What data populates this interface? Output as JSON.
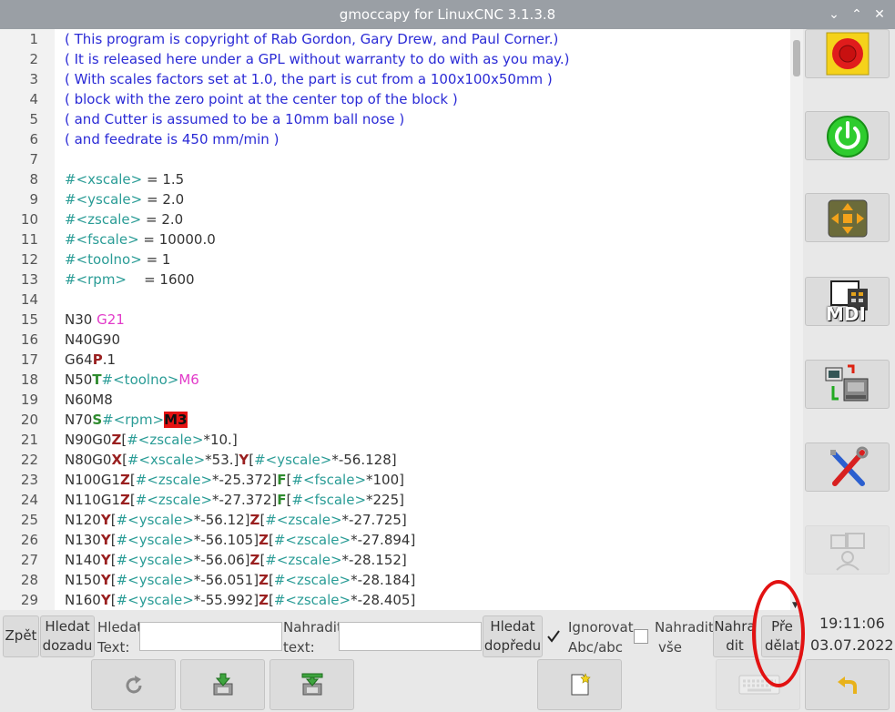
{
  "window": {
    "title": "gmoccapy for LinuxCNC  3.1.3.8",
    "min_icon": "chevron-down-icon",
    "max_icon": "chevron-up-icon",
    "close_icon": "close-icon",
    "min": "⌄",
    "max": "⌃",
    "close": "✕"
  },
  "editor": {
    "lines": [
      {
        "n": "1",
        "parts": [
          [
            "cm",
            "( This program is copyright of Rab Gordon, Gary Drew, and Paul Corner.)"
          ]
        ]
      },
      {
        "n": "2",
        "parts": [
          [
            "cm",
            "( It is released here under a GPL without warranty to do with as you may.)"
          ]
        ]
      },
      {
        "n": "3",
        "parts": [
          [
            "cm",
            "( With scales factors set at 1.0, the part is cut from a 100x100x50mm )"
          ]
        ]
      },
      {
        "n": "4",
        "parts": [
          [
            "cm",
            "( block with the zero point at the center top of the block )"
          ]
        ]
      },
      {
        "n": "5",
        "parts": [
          [
            "cm",
            "( and Cutter is assumed to be a 10mm ball nose )"
          ]
        ]
      },
      {
        "n": "6",
        "parts": [
          [
            "cm",
            "( and feedrate is 450 mm/min )"
          ]
        ]
      },
      {
        "n": "7",
        "parts": []
      },
      {
        "n": "8",
        "parts": [
          [
            "var",
            "#<xscale>"
          ],
          [
            "txt",
            " = 1.5"
          ]
        ]
      },
      {
        "n": "9",
        "parts": [
          [
            "var",
            "#<yscale>"
          ],
          [
            "txt",
            " = 2.0"
          ]
        ]
      },
      {
        "n": "10",
        "parts": [
          [
            "var",
            "#<zscale>"
          ],
          [
            "txt",
            " = 2.0"
          ]
        ]
      },
      {
        "n": "11",
        "parts": [
          [
            "var",
            "#<fscale>"
          ],
          [
            "txt",
            " = 10000.0"
          ]
        ]
      },
      {
        "n": "12",
        "parts": [
          [
            "var",
            "#<toolno>"
          ],
          [
            "txt",
            " = 1"
          ]
        ]
      },
      {
        "n": "13",
        "parts": [
          [
            "var",
            "#<rpm>"
          ],
          [
            "txt",
            "    = 1600"
          ]
        ]
      },
      {
        "n": "14",
        "parts": []
      },
      {
        "n": "15",
        "parts": [
          [
            "txt",
            "N30 "
          ],
          [
            "g",
            "G21"
          ]
        ]
      },
      {
        "n": "16",
        "parts": [
          [
            "txt",
            "N40G90"
          ]
        ]
      },
      {
        "n": "17",
        "parts": [
          [
            "txt",
            "G64"
          ],
          [
            "addr",
            "P"
          ],
          [
            "txt",
            ".1"
          ]
        ]
      },
      {
        "n": "18",
        "parts": [
          [
            "txt",
            "N50"
          ],
          [
            "addrg",
            "T"
          ],
          [
            "var",
            "#<toolno>"
          ],
          [
            "g",
            "M6"
          ]
        ]
      },
      {
        "n": "19",
        "parts": [
          [
            "txt",
            "N60M8"
          ]
        ]
      },
      {
        "n": "20",
        "parts": [
          [
            "txt",
            "N70"
          ],
          [
            "addrg",
            "S"
          ],
          [
            "var",
            "#<rpm>"
          ],
          [
            "hl",
            "M3"
          ]
        ]
      },
      {
        "n": "21",
        "parts": [
          [
            "txt",
            "N90G0"
          ],
          [
            "addr",
            "Z"
          ],
          [
            "txt",
            "["
          ],
          [
            "var",
            "#<zscale>"
          ],
          [
            "txt",
            "*10.]"
          ]
        ]
      },
      {
        "n": "22",
        "parts": [
          [
            "txt",
            "N80G0"
          ],
          [
            "addr",
            "X"
          ],
          [
            "txt",
            "["
          ],
          [
            "var",
            "#<xscale>"
          ],
          [
            "txt",
            "*53.]"
          ],
          [
            "addr",
            "Y"
          ],
          [
            "txt",
            "["
          ],
          [
            "var",
            "#<yscale>"
          ],
          [
            "txt",
            "*-56.128]"
          ]
        ]
      },
      {
        "n": "23",
        "parts": [
          [
            "txt",
            "N100G1"
          ],
          [
            "addr",
            "Z"
          ],
          [
            "txt",
            "["
          ],
          [
            "var",
            "#<zscale>"
          ],
          [
            "txt",
            "*-25.372]"
          ],
          [
            "addrg",
            "F"
          ],
          [
            "txt",
            "["
          ],
          [
            "var",
            "#<fscale>"
          ],
          [
            "txt",
            "*100]"
          ]
        ]
      },
      {
        "n": "24",
        "parts": [
          [
            "txt",
            "N110G1"
          ],
          [
            "addr",
            "Z"
          ],
          [
            "txt",
            "["
          ],
          [
            "var",
            "#<zscale>"
          ],
          [
            "txt",
            "*-27.372]"
          ],
          [
            "addrg",
            "F"
          ],
          [
            "txt",
            "["
          ],
          [
            "var",
            "#<fscale>"
          ],
          [
            "txt",
            "*225]"
          ]
        ]
      },
      {
        "n": "25",
        "parts": [
          [
            "txt",
            "N120"
          ],
          [
            "addr",
            "Y"
          ],
          [
            "txt",
            "["
          ],
          [
            "var",
            "#<yscale>"
          ],
          [
            "txt",
            "*-56.12]"
          ],
          [
            "addr",
            "Z"
          ],
          [
            "txt",
            "["
          ],
          [
            "var",
            "#<zscale>"
          ],
          [
            "txt",
            "*-27.725]"
          ]
        ]
      },
      {
        "n": "26",
        "parts": [
          [
            "txt",
            "N130"
          ],
          [
            "addr",
            "Y"
          ],
          [
            "txt",
            "["
          ],
          [
            "var",
            "#<yscale>"
          ],
          [
            "txt",
            "*-56.105]"
          ],
          [
            "addr",
            "Z"
          ],
          [
            "txt",
            "["
          ],
          [
            "var",
            "#<zscale>"
          ],
          [
            "txt",
            "*-27.894]"
          ]
        ]
      },
      {
        "n": "27",
        "parts": [
          [
            "txt",
            "N140"
          ],
          [
            "addr",
            "Y"
          ],
          [
            "txt",
            "["
          ],
          [
            "var",
            "#<yscale>"
          ],
          [
            "txt",
            "*-56.06]"
          ],
          [
            "addr",
            "Z"
          ],
          [
            "txt",
            "["
          ],
          [
            "var",
            "#<zscale>"
          ],
          [
            "txt",
            "*-28.152]"
          ]
        ]
      },
      {
        "n": "28",
        "parts": [
          [
            "txt",
            "N150"
          ],
          [
            "addr",
            "Y"
          ],
          [
            "txt",
            "["
          ],
          [
            "var",
            "#<yscale>"
          ],
          [
            "txt",
            "*-56.051]"
          ],
          [
            "addr",
            "Z"
          ],
          [
            "txt",
            "["
          ],
          [
            "var",
            "#<zscale>"
          ],
          [
            "txt",
            "*-28.184]"
          ]
        ]
      },
      {
        "n": "29",
        "parts": [
          [
            "txt",
            "N160"
          ],
          [
            "addr",
            "Y"
          ],
          [
            "txt",
            "["
          ],
          [
            "var",
            "#<yscale>"
          ],
          [
            "txt",
            "*-55.992]"
          ],
          [
            "addr",
            "Z"
          ],
          [
            "txt",
            "["
          ],
          [
            "var",
            "#<zscale>"
          ],
          [
            "txt",
            "*-28.405]"
          ]
        ]
      }
    ]
  },
  "sidebar": {
    "estop_icon": "emergency-stop-icon",
    "estop_label": "Emergency Stop",
    "power_icon": "power-icon",
    "manual_icon": "jog-arrows-icon",
    "mdi_icon": "mdi-icon",
    "mdi_label": "MDI",
    "auto_icon": "auto-mode-icon",
    "settings_icon": "tools-icon",
    "user_tabs_icon": "user-tabs-icon"
  },
  "search_bar": {
    "undo": "Zpět",
    "find_back_1": "Hledat",
    "find_back_2": "dozadu",
    "search_label_1": "Hledat",
    "search_label_2": "Text:",
    "search_value": "",
    "replace_label_1": "Nahradit",
    "replace_label_2": "text:",
    "replace_value": "",
    "find_fwd_1": "Hledat",
    "find_fwd_2": "dopředu",
    "ignore_case_1": "Ignorovat",
    "ignore_case_2": "Abc/abc",
    "ignore_case_checked": true,
    "replace_all_1": "Nahradit",
    "replace_all_2": "vše",
    "replace_all_checked": false,
    "replace_1": "Nahra",
    "replace_2": "dit",
    "redo_1": "Pře",
    "redo_2": "dělat"
  },
  "status": {
    "time": "19:11:06",
    "date": "03.07.2022"
  },
  "toolbar": {
    "reload_icon": "reload-icon",
    "save_icon": "save-icon",
    "save_as_icon": "save-as-icon",
    "new_icon": "new-file-icon",
    "keyboard_icon": "keyboard-icon",
    "back_icon": "back-arrow-icon"
  },
  "annotation_color": "#e21212"
}
